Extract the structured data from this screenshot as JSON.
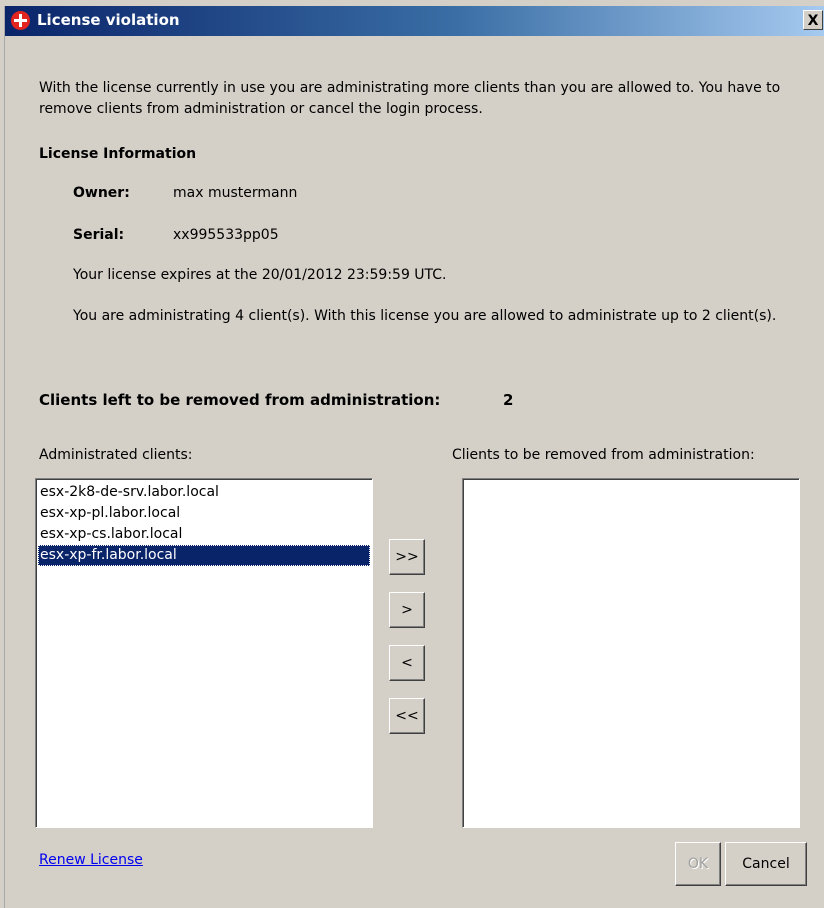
{
  "window": {
    "title": "License violation",
    "close_label": "X"
  },
  "intro_text": "With the license currently in use you are administrating more clients than you are allowed to. You have to remove clients from administration or cancel the login process.",
  "license_info": {
    "heading": "License Information",
    "owner_label": "Owner:",
    "owner_value": "max mustermann",
    "serial_label": "Serial:",
    "serial_value": "xx995533pp05",
    "expires_text": "Your license expires at the 20/01/2012 23:59:59 UTC.",
    "admin_text": "You are administrating 4 client(s). With this license you are allowed to administrate up to 2 client(s)."
  },
  "clients_left": {
    "label": "Clients left to be removed from administration:",
    "value": "2"
  },
  "administrated_list": {
    "label": "Administrated clients:",
    "items": [
      "esx-2k8-de-srv.labor.local",
      "esx-xp-pl.labor.local",
      "esx-xp-cs.labor.local",
      "esx-xp-fr.labor.local"
    ],
    "selected_index": 3
  },
  "removed_list": {
    "label": "Clients to be removed from administration:",
    "items": []
  },
  "move_buttons": {
    "move_all_right": ">>",
    "move_right": ">",
    "move_left": "<",
    "move_all_left": "<<"
  },
  "footer": {
    "renew_link": "Renew License",
    "ok_label": "OK",
    "ok_enabled": false,
    "cancel_label": "Cancel"
  },
  "colors": {
    "title_gradient_start": "#0a246a",
    "title_gradient_end": "#a6caf0",
    "selection": "#0a246a",
    "dialog_background": "#d4d0c8",
    "link": "#0000ee"
  },
  "icons": {
    "title_icon": "red-cross-icon",
    "close_icon": "close-icon"
  }
}
